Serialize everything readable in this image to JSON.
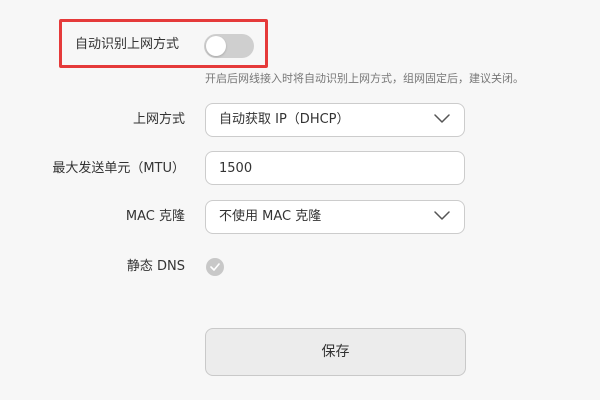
{
  "auto_detect": {
    "label": "自动识别上网方式",
    "enabled": false,
    "hint": "开启后网线接入时将自动识别上网方式，组网固定后，建议关闭。"
  },
  "connection_mode": {
    "label": "上网方式",
    "selected": "自动获取 IP（DHCP）"
  },
  "mtu": {
    "label": "最大发送单元（MTU）",
    "value": "1500"
  },
  "mac_clone": {
    "label": "MAC 克隆",
    "selected": "不使用 MAC 克隆"
  },
  "static_dns": {
    "label": "静态 DNS",
    "checked": false
  },
  "save": {
    "label": "保存"
  },
  "colors": {
    "highlight_border": "#e53a3a",
    "toggle_off": "#cfcfcf",
    "background": "#f7f7f7"
  },
  "icons": {
    "toggle": "toggle-switch-off",
    "dropdown": "chevron-down-icon",
    "checkbox": "check-circle-icon"
  }
}
